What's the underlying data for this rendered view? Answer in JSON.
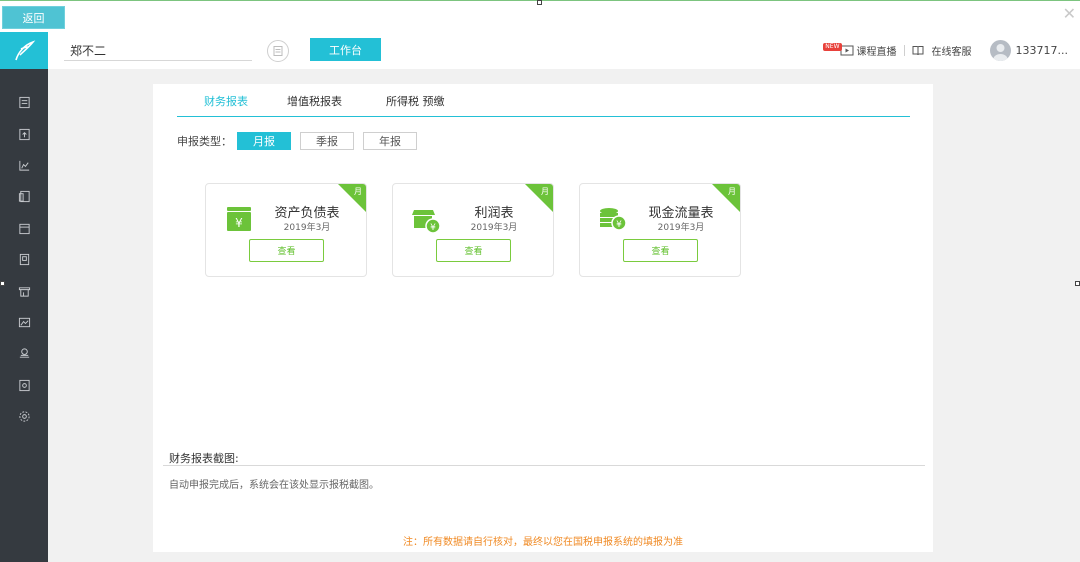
{
  "topbar": {
    "back_label": "返回",
    "close_icon": "close-icon"
  },
  "header": {
    "company_name": "郑不二",
    "workbench_label": "工作台",
    "new_badge": "NEW",
    "course_live": "课程直播",
    "online_service": "在线客服",
    "user_name": "133717..."
  },
  "sidebar": {
    "icons": [
      "doc-icon",
      "upload-icon",
      "chart-icon",
      "report-icon",
      "calendar-icon",
      "ledger-icon",
      "shop-icon",
      "image-icon",
      "stamp-icon",
      "invoice-icon",
      "settings-icon"
    ]
  },
  "tabs": [
    {
      "label": "财务报表",
      "active": true
    },
    {
      "label": "增值税报表",
      "active": false
    },
    {
      "label": "所得税 预缴",
      "active": false
    }
  ],
  "report_type": {
    "label": "申报类型：",
    "options": [
      "月报",
      "季报",
      "年报"
    ],
    "selected": "月报"
  },
  "cards": [
    {
      "title": "资产负债表",
      "date": "2019年3月",
      "button": "查看",
      "corner": "月",
      "icon": "yen-box-icon"
    },
    {
      "title": "利润表",
      "date": "2019年3月",
      "button": "查看",
      "corner": "月",
      "icon": "shop-yen-icon"
    },
    {
      "title": "现金流量表",
      "date": "2019年3月",
      "button": "查看",
      "corner": "月",
      "icon": "coins-yen-icon"
    }
  ],
  "screenshot_section": {
    "title": "财务报表截图:",
    "text": "自动申报完成后，系统会在该处显示报税截图。"
  },
  "note": "注：所有数据请自行核对，最终以您在国税申报系统的填报为准",
  "colors": {
    "accent": "#23c0d6",
    "green": "#6cc33a",
    "sidebar": "#353a40",
    "note": "#f08a24"
  }
}
